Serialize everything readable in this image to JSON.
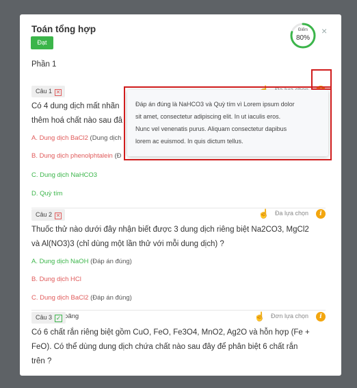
{
  "header": {
    "title": "Toán tổng hợp",
    "status": "Đạt",
    "score_label": "Điểm",
    "score_value": "80%",
    "score_fraction": 0.8,
    "close_icon": "×"
  },
  "section_title": "Phần 1",
  "questions": [
    {
      "tag": "Câu 1",
      "result_icon": "✕",
      "type": "Đa lựa chọn",
      "text": "Có 4 dung dịch mất nhãn ... thêm hoá chất nào sau đây",
      "text_line1": "Có 4 dung dịch mất nhãn",
      "text_line2": "thêm hoá chất nào sau đâ",
      "options": [
        {
          "label": "A. Dung dịch BaCl2",
          "note": " (Dung dịch"
        },
        {
          "label": "B. Dung dịch phenolphtalein",
          "note": " (Đ"
        },
        {
          "label": "C. Dung dịch NaHCO3",
          "note": ""
        },
        {
          "label": "D. Quỳ tím",
          "note": ""
        }
      ]
    },
    {
      "tag": "Câu 2",
      "result_icon": "✕",
      "type": "Đa lựa chọn",
      "text_line1": "Thuốc thử nào dưới đây nhận biết được 3 dung dịch riêng biệt Na2CO3, MgCl2",
      "text_line2": "và Al(NO3)3 (chỉ dùng một lần thử với mỗi dung dịch) ?",
      "options": [
        {
          "label": "A. Dung dịch NaOH",
          "note": " (Đáp án đúng)"
        },
        {
          "label": "B. Dung dịch HCl",
          "note": ""
        },
        {
          "label": "C. Dung dịch BaCl2",
          "note": " (Đáp án đúng)"
        },
        {
          "label": "D. H2SO4 loãng",
          "note": ""
        }
      ]
    },
    {
      "tag": "Câu 3",
      "result_icon": "✓",
      "type": "Đơn lựa chọn",
      "text_line1": "Có 6 chất rắn riêng biệt gồm CuO, FeO, Fe3O4, MnO2, Ag2O và hỗn hợp (Fe +",
      "text_line2": "FeO). Có thể dùng dung dịch chứa chất nào sau đây để phân biệt 6 chất rắn",
      "text_line3": "trên ?"
    }
  ],
  "tooltip": {
    "line1": "Đáp án đúng là NaHCO3 và Quỳ tím vì Lorem ipsum dolor",
    "line2": "sit amet, consectetur adipiscing elit. In ut iaculis eros.",
    "line3": "Nunc vel venenatis purus. Aliquam consectetur dapibus",
    "line4": "lorem ac euismod. In quis dictum tellus."
  },
  "icons": {
    "info": "info-icon",
    "hand": "pointer-hand-icon",
    "close": "close-icon"
  },
  "colors": {
    "correct": "#3bb54a",
    "wrong": "#e05a5a",
    "info": "#f3a60f",
    "highlight": "#d01c1c"
  }
}
